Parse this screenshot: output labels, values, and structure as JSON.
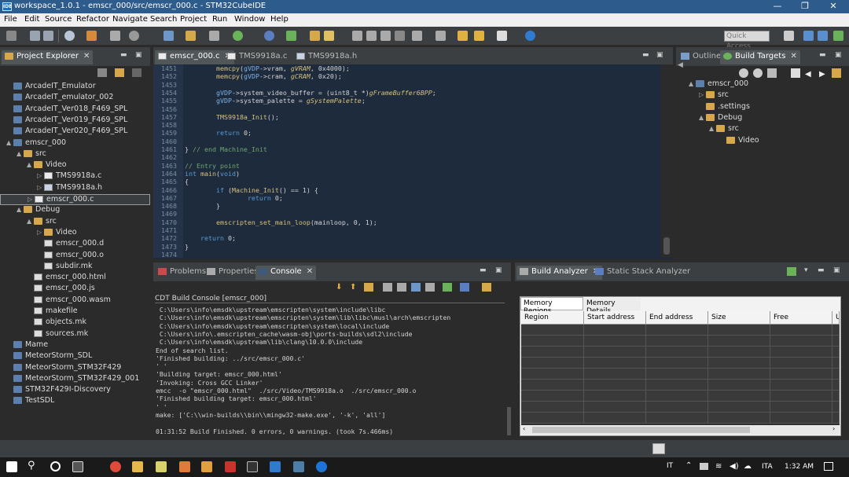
{
  "title_bar": {
    "icon_label": "IDE",
    "title": "workspace_1.0.1 - emscr_000/src/emscr_000.c - STM32CubeIDE",
    "minimize": "—",
    "restore": "❐",
    "close": "✕"
  },
  "menu": [
    "File",
    "Edit",
    "Source",
    "Refactor",
    "Navigate",
    "Search",
    "Project",
    "Run",
    "Window",
    "Help"
  ],
  "quick_access": "Quick Access",
  "project_explorer": {
    "tab": "Project Explorer",
    "items": [
      {
        "label": "ArcadeIT_Emulator",
        "icon": "project-icon",
        "depth": 0,
        "arrow": ""
      },
      {
        "label": "ArcadeIT_emulator_002",
        "icon": "project-icon",
        "depth": 0,
        "arrow": ""
      },
      {
        "label": "ArcadeIT_Ver018_F469_SPL",
        "icon": "project-icon",
        "depth": 0,
        "arrow": ""
      },
      {
        "label": "ArcadeIT_Ver019_F469_SPL",
        "icon": "project-icon",
        "depth": 0,
        "arrow": ""
      },
      {
        "label": "ArcadeIT_Ver020_F469_SPL",
        "icon": "project-icon",
        "depth": 0,
        "arrow": ""
      },
      {
        "label": "emscr_000",
        "icon": "project-icon",
        "depth": 0,
        "arrow": "▲"
      },
      {
        "label": "src",
        "icon": "folder-icon",
        "depth": 1,
        "arrow": "▲"
      },
      {
        "label": "Video",
        "icon": "folder-icon",
        "depth": 2,
        "arrow": "▲"
      },
      {
        "label": "TMS9918a.c",
        "icon": "c-file-icon",
        "depth": 3,
        "arrow": "▷"
      },
      {
        "label": "TMS9918a.h",
        "icon": "h-file-icon",
        "depth": 3,
        "arrow": "▷"
      },
      {
        "label": "emscr_000.c",
        "icon": "c-file-icon",
        "depth": 2,
        "arrow": "▷",
        "selected": true
      },
      {
        "label": "Debug",
        "icon": "folder-icon",
        "depth": 1,
        "arrow": "▲"
      },
      {
        "label": "src",
        "icon": "folder-icon",
        "depth": 2,
        "arrow": "▲"
      },
      {
        "label": "Video",
        "icon": "folder-icon",
        "depth": 3,
        "arrow": "▷"
      },
      {
        "label": "emscr_000.d",
        "icon": "file-icon",
        "depth": 3,
        "arrow": ""
      },
      {
        "label": "emscr_000.o",
        "icon": "file-icon",
        "depth": 3,
        "arrow": ""
      },
      {
        "label": "subdir.mk",
        "icon": "file-icon",
        "depth": 3,
        "arrow": ""
      },
      {
        "label": "emscr_000.html",
        "icon": "file-icon",
        "depth": 2,
        "arrow": ""
      },
      {
        "label": "emscr_000.js",
        "icon": "file-icon",
        "depth": 2,
        "arrow": ""
      },
      {
        "label": "emscr_000.wasm",
        "icon": "file-icon",
        "depth": 2,
        "arrow": ""
      },
      {
        "label": "makefile",
        "icon": "file-icon",
        "depth": 2,
        "arrow": ""
      },
      {
        "label": "objects.mk",
        "icon": "file-icon",
        "depth": 2,
        "arrow": ""
      },
      {
        "label": "sources.mk",
        "icon": "file-icon",
        "depth": 2,
        "arrow": ""
      },
      {
        "label": "Mame",
        "icon": "project-icon",
        "depth": 0,
        "arrow": ""
      },
      {
        "label": "MeteorStorm_SDL",
        "icon": "project-icon",
        "depth": 0,
        "arrow": ""
      },
      {
        "label": "MeteorStorm_STM32F429",
        "icon": "project-icon",
        "depth": 0,
        "arrow": ""
      },
      {
        "label": "MeteorStorm_STM32F429_001",
        "icon": "project-icon",
        "depth": 0,
        "arrow": ""
      },
      {
        "label": "STM32F429I-Discovery",
        "icon": "project-icon",
        "depth": 0,
        "arrow": ""
      },
      {
        "label": "TestSDL",
        "icon": "project-icon",
        "depth": 0,
        "arrow": ""
      }
    ]
  },
  "editor": {
    "tabs": [
      "emscr_000.c",
      "TMS9918a.c",
      "TMS9918a.h"
    ],
    "lines": [
      {
        "n": "1451",
        "t": "        memcpy(gVDP->vram, gVRAM, 0x4000);"
      },
      {
        "n": "1452",
        "t": "        memcpy(gVDP->cram, gCRAM, 0x20);"
      },
      {
        "n": "1453",
        "t": ""
      },
      {
        "n": "1454",
        "t": "        gVDP->system_video_buffer = (uint8_t *)gFrameBuffer6BPP;"
      },
      {
        "n": "1455",
        "t": "        gVDP->system_palette = gSystemPalette;"
      },
      {
        "n": "1456",
        "t": ""
      },
      {
        "n": "1457",
        "t": "        TMS9918a_Init();"
      },
      {
        "n": "1458",
        "t": ""
      },
      {
        "n": "1459",
        "t": "        return 0;"
      },
      {
        "n": "1460",
        "t": ""
      },
      {
        "n": "1461",
        "t": "} // end Machine_Init"
      },
      {
        "n": "1462",
        "t": ""
      },
      {
        "n": "1463",
        "t": "// Entry point"
      },
      {
        "n": "1464",
        "t": "int main(void)"
      },
      {
        "n": "1465",
        "t": "{"
      },
      {
        "n": "1466",
        "t": "        if (Machine_Init() == 1) {"
      },
      {
        "n": "1467",
        "t": "                return 0;"
      },
      {
        "n": "1468",
        "t": "        }"
      },
      {
        "n": "1469",
        "t": ""
      },
      {
        "n": "1470",
        "t": "        emscripten_set_main_loop(mainloop, 0, 1);"
      },
      {
        "n": "1471",
        "t": ""
      },
      {
        "n": "1472",
        "t": "    return 0;"
      },
      {
        "n": "1473",
        "t": "}"
      },
      {
        "n": "1474",
        "t": ""
      }
    ]
  },
  "outline": {
    "tabs": [
      "Outline",
      "Build Targets"
    ],
    "items": [
      {
        "label": "emscr_000",
        "icon": "project-icon",
        "depth": 0,
        "arrow": "▲"
      },
      {
        "label": "src",
        "icon": "folder-icon",
        "depth": 1,
        "arrow": "▷"
      },
      {
        "label": ".settings",
        "icon": "folder-icon",
        "depth": 1,
        "arrow": ""
      },
      {
        "label": "Debug",
        "icon": "folder-icon",
        "depth": 1,
        "arrow": "▲"
      },
      {
        "label": "src",
        "icon": "folder-icon",
        "depth": 2,
        "arrow": "▲"
      },
      {
        "label": "Video",
        "icon": "folder-icon",
        "depth": 3,
        "arrow": ""
      }
    ]
  },
  "console": {
    "tabs": [
      "Problems",
      "Properties",
      "Console"
    ],
    "title": "CDT Build Console [emscr_000]",
    "lines": [
      " C:\\Users\\info\\emsdk\\upstream\\emscripten\\system\\include\\libc",
      " C:\\Users\\info\\emsdk\\upstream\\emscripten\\system\\lib\\libc\\musl\\arch\\emscripten",
      " C:\\Users\\info\\emsdk\\upstream\\emscripten\\system\\local\\include",
      " C:\\Users\\info\\.emscripten_cache\\wasm-obj\\ports-builds\\sdl2\\include",
      " C:\\Users\\info\\emsdk\\upstream\\lib\\clang\\10.0.0\\include",
      "End of search list.",
      "'Finished building: ../src/emscr_000.c'",
      "' '",
      "'Building target: emscr_000.html'",
      "'Invoking: Cross GCC Linker'",
      "emcc  -o \"emscr_000.html\"  ./src/Video/TMS9918a.o  ./src/emscr_000.o",
      "'Finished building target: emscr_000.html'",
      "' '",
      "make: ['C:\\\\win-builds\\\\bin\\\\mingw32-make.exe', '-k', 'all']",
      "",
      "01:31:52 Build Finished. 0 errors, 0 warnings. (took 7s.466ms)"
    ]
  },
  "build_analyzer": {
    "tabs": [
      "Build Analyzer",
      "Static Stack Analyzer"
    ],
    "subtabs": [
      "Memory Regions",
      "Memory Details"
    ],
    "columns": [
      "Region",
      "Start address",
      "End address",
      "Size",
      "Free",
      "U"
    ]
  },
  "taskbar": {
    "lang_short": "IT",
    "lang": "ITA",
    "time": "1:32 AM"
  }
}
